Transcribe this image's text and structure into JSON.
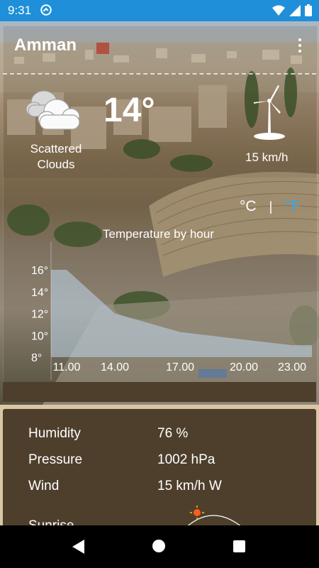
{
  "status_bar": {
    "time": "9:31"
  },
  "header": {
    "city": "Amman"
  },
  "current": {
    "condition_line1": "Scattered",
    "condition_line2": "Clouds",
    "temperature": "14°",
    "wind_speed": "15 km/h"
  },
  "units": {
    "celsius": "°C",
    "separator": "|",
    "fahrenheit": "°F",
    "active_color": "#2aa8f0"
  },
  "chart_data": {
    "type": "area",
    "title": "Temperature by hour",
    "x_tick_labels": [
      "11.00",
      "14.00",
      "17.00",
      "20.00",
      "23.00"
    ],
    "y_tick_labels": [
      "16°",
      "14°",
      "12°",
      "10°",
      "8°"
    ],
    "ylim": [
      8,
      16
    ],
    "x": [
      "11.00",
      "14.00",
      "17.00",
      "20.00",
      "23.00"
    ],
    "values": [
      16,
      12,
      10.3,
      9.6,
      9.1
    ]
  },
  "details": {
    "humidity_label": "Humidity",
    "humidity_value": "76 %",
    "pressure_label": "Pressure",
    "pressure_value": "1002 hPa",
    "wind_label": "Wind",
    "wind_value": "15 km/h W",
    "sunrise_label": "Sunrise"
  }
}
